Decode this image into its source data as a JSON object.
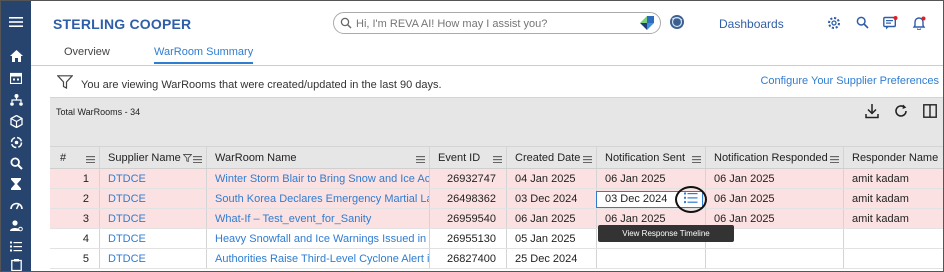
{
  "header": {
    "brand": "STERLING COOPER",
    "search_placeholder": "Hi, I'm REVA AI! How may I assist you?",
    "dashboards_link": "Dashboards"
  },
  "tabs": [
    {
      "label": "Overview",
      "active": false
    },
    {
      "label": "WarRoom Summary",
      "active": true
    }
  ],
  "info": {
    "message": "You are viewing WarRooms that were created/updated in the last 90 days.",
    "configure_link": "Configure Your Supplier Preferences"
  },
  "toolbar": {
    "total_label": "Total WarRooms - 34"
  },
  "table": {
    "columns": [
      "#",
      "Supplier Name",
      "WarRoom Name",
      "Event ID",
      "Created Date",
      "Notification Sent",
      "Notification Responded",
      "Responder Name"
    ],
    "rows": [
      {
        "num": "1",
        "supplier": "DTDCE",
        "warroom": "Winter Storm Blair to Bring Snow and Ice Acro",
        "event_id": "26932747",
        "created": "04 Jan 2025",
        "sent": "06 Jan 2025",
        "responded": "06 Jan 2025",
        "responder": "amit kadam",
        "highlight": true
      },
      {
        "num": "2",
        "supplier": "DTDCE",
        "warroom": "South Korea Declares Emergency Martial Law",
        "event_id": "26498362",
        "created": "03 Dec 2024",
        "sent": "03 Dec 2024",
        "responded": "06 Jan 2025",
        "responder": "amit kadam",
        "highlight": true
      },
      {
        "num": "3",
        "supplier": "DTDCE",
        "warroom": "What-If – Test_event_for_Sanity",
        "event_id": "26959540",
        "created": "06 Jan 2025",
        "sent": "06 Jan 2025",
        "responded": "06 Jan 2025",
        "responder": "amit kadam",
        "highlight": true
      },
      {
        "num": "4",
        "supplier": "DTDCE",
        "warroom": "Heavy Snowfall and Ice Warnings Issued in Par",
        "event_id": "26955130",
        "created": "05 Jan 2025",
        "sent": "",
        "responded": "",
        "responder": "",
        "highlight": false
      },
      {
        "num": "5",
        "supplier": "DTDCE",
        "warroom": "Authorities Raise Third-Level Cyclone Alert in T",
        "event_id": "26827400",
        "created": "25 Dec 2024",
        "sent": "",
        "responded": "",
        "responder": "",
        "highlight": false
      }
    ]
  },
  "tooltip": "View Response Timeline",
  "colors": {
    "sidebar": "#27446e",
    "brand": "#2f5ea8",
    "link": "#2f7dd1",
    "highlight_row": "#fbe1e1",
    "grid_header": "#e6e6e6"
  },
  "sidebar_icons": [
    "home-icon",
    "calendar-icon",
    "hierarchy-icon",
    "cube-icon",
    "settings-cycle-icon",
    "search-icon",
    "hourglass-icon",
    "gauge-icon",
    "user-settings-icon",
    "list-icon",
    "clipboard-icon"
  ]
}
